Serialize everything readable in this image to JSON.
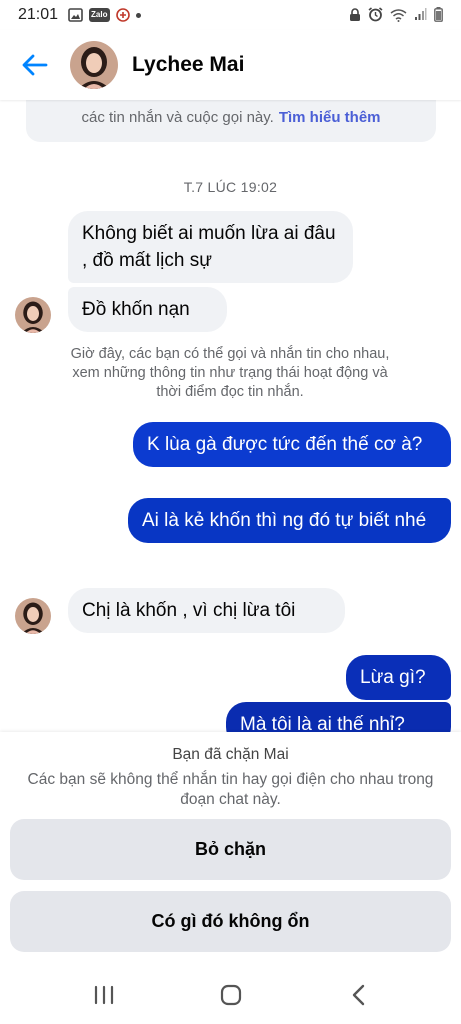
{
  "status_bar": {
    "time": "21:01",
    "app_icons": [
      "gallery-icon",
      "zalo-icon",
      "app-icon",
      "notification-dot"
    ],
    "zalo_label": "Zalo",
    "system_icons": [
      "lock-icon",
      "alarm-icon",
      "wifi-icon",
      "signal-icon",
      "battery-icon"
    ]
  },
  "header": {
    "contact_name": "Lychee Mai"
  },
  "info_box": {
    "text": "các tin nhắn và cuộc gọi này.",
    "link": "Tìm hiểu thêm"
  },
  "conversation": {
    "timestamp": "T.7 LÚC 19:02",
    "messages": [
      {
        "direction": "incoming",
        "text": "Không biết ai muốn lừa ai đâu , đồ mất lịch sự"
      },
      {
        "direction": "incoming",
        "text": "Đồ khốn nạn"
      },
      {
        "direction": "outgoing",
        "text": "K lùa gà được tức đến thế cơ à?"
      },
      {
        "direction": "outgoing",
        "text": "Ai là kẻ khốn thì ng đó tự biết nhé"
      },
      {
        "direction": "incoming",
        "text": "Chị là khốn , vì chị lừa tôi"
      },
      {
        "direction": "outgoing",
        "text": "Lừa gì?"
      },
      {
        "direction": "outgoing",
        "text": "Mà tôi là ai thế nhỉ?"
      }
    ],
    "system_note": "Giờ đây, các bạn có thể gọi và nhắn tin cho nhau, xem những thông tin như trạng thái hoạt động và thời điểm đọc tin nhắn."
  },
  "blocked_panel": {
    "title": "Bạn đã chặn Mai",
    "description": "Các bạn sẽ không thể nhắn tin hay gọi điện cho nhau trong đoạn chat này.",
    "unblock_label": "Bỏ chặn",
    "report_label": "Có gì đó không ổn"
  },
  "colors": {
    "accent": "#0084ff",
    "outgoing_bubble": "#0a3ccf",
    "incoming_bubble": "#f0f2f5",
    "link": "#4b5fd6"
  }
}
